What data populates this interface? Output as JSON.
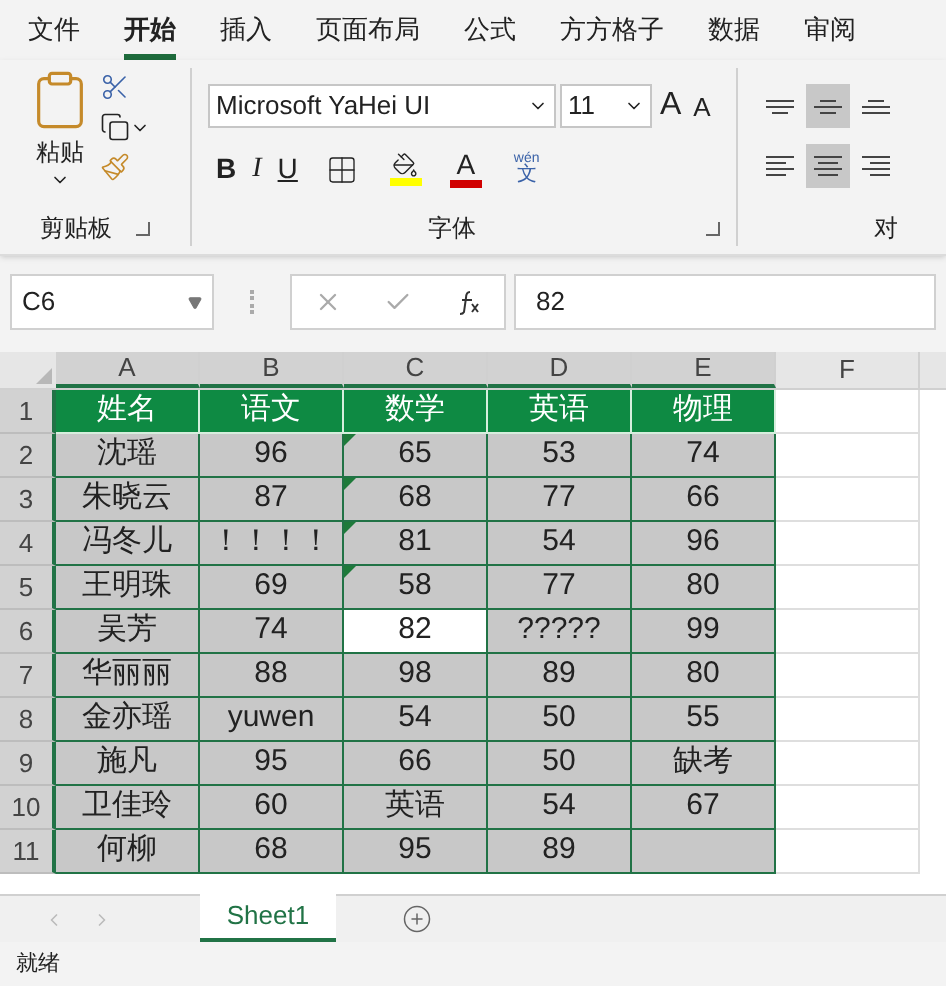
{
  "ribbon_tabs": [
    {
      "label": "文件",
      "selected": false
    },
    {
      "label": "开始",
      "selected": true
    },
    {
      "label": "插入",
      "selected": false
    },
    {
      "label": "页面布局",
      "selected": false
    },
    {
      "label": "公式",
      "selected": false
    },
    {
      "label": "方方格子",
      "selected": false
    },
    {
      "label": "数据",
      "selected": false
    },
    {
      "label": "审阅",
      "selected": false
    }
  ],
  "clipboard": {
    "paste_label": "粘贴",
    "group_label": "剪贴板"
  },
  "font": {
    "name": "Microsoft YaHei UI",
    "size": "11",
    "grow": "A",
    "shrink": "A",
    "bold": "B",
    "italic": "I",
    "underline": "U",
    "font_color": "A",
    "phonetic_top": "wén",
    "phonetic_bottom": "文",
    "group_label": "字体"
  },
  "alignment": {
    "group_label": "对",
    "top_row": [
      {
        "kind": "top",
        "selected": false
      },
      {
        "kind": "middle",
        "selected": true
      },
      {
        "kind": "bottom",
        "selected": false
      }
    ],
    "bottom_row": [
      {
        "kind": "left",
        "selected": false
      },
      {
        "kind": "center",
        "selected": true
      },
      {
        "kind": "right",
        "selected": false
      }
    ]
  },
  "formula_bar": {
    "name_box": "C6",
    "value": "82"
  },
  "columns": [
    "A",
    "B",
    "C",
    "D",
    "E",
    "F"
  ],
  "rows": [
    {
      "number": "1",
      "header": true,
      "cells": [
        {
          "text": "姓名"
        },
        {
          "text": "语文"
        },
        {
          "text": "数学"
        },
        {
          "text": "英语"
        },
        {
          "text": "物理"
        }
      ]
    },
    {
      "number": "2",
      "header": false,
      "cells": [
        {
          "text": "沈瑶",
          "selected": false,
          "error_flag": false
        },
        {
          "text": "96",
          "selected": false,
          "error_flag": false
        },
        {
          "text": "65",
          "selected": false,
          "error_flag": true
        },
        {
          "text": "53",
          "selected": false,
          "error_flag": false
        },
        {
          "text": "74",
          "selected": false,
          "error_flag": false
        }
      ]
    },
    {
      "number": "3",
      "header": false,
      "cells": [
        {
          "text": "朱晓云",
          "selected": false,
          "error_flag": false
        },
        {
          "text": "87",
          "selected": false,
          "error_flag": false
        },
        {
          "text": "68",
          "selected": false,
          "error_flag": true
        },
        {
          "text": "77",
          "selected": false,
          "error_flag": false
        },
        {
          "text": "66",
          "selected": false,
          "error_flag": false
        }
      ]
    },
    {
      "number": "4",
      "header": false,
      "cells": [
        {
          "text": "冯冬儿",
          "selected": false,
          "error_flag": false
        },
        {
          "text": "！！！！",
          "selected": false,
          "error_flag": false
        },
        {
          "text": "81",
          "selected": false,
          "error_flag": true
        },
        {
          "text": "54",
          "selected": false,
          "error_flag": false
        },
        {
          "text": "96",
          "selected": false,
          "error_flag": false
        }
      ]
    },
    {
      "number": "5",
      "header": false,
      "cells": [
        {
          "text": "王明珠",
          "selected": false,
          "error_flag": false
        },
        {
          "text": "69",
          "selected": false,
          "error_flag": false
        },
        {
          "text": "58",
          "selected": false,
          "error_flag": true
        },
        {
          "text": "77",
          "selected": false,
          "error_flag": false
        },
        {
          "text": "80",
          "selected": false,
          "error_flag": false
        }
      ]
    },
    {
      "number": "6",
      "header": false,
      "cells": [
        {
          "text": "吴芳",
          "selected": false,
          "error_flag": false
        },
        {
          "text": "74",
          "selected": false,
          "error_flag": false
        },
        {
          "text": "82",
          "selected": true,
          "error_flag": false
        },
        {
          "text": "?????",
          "selected": false,
          "error_flag": false
        },
        {
          "text": "99",
          "selected": false,
          "error_flag": false
        }
      ]
    },
    {
      "number": "7",
      "header": false,
      "cells": [
        {
          "text": "华丽丽",
          "selected": false,
          "error_flag": false
        },
        {
          "text": "88",
          "selected": false,
          "error_flag": false
        },
        {
          "text": "98",
          "selected": false,
          "error_flag": false
        },
        {
          "text": "89",
          "selected": false,
          "error_flag": false
        },
        {
          "text": "80",
          "selected": false,
          "error_flag": false
        }
      ]
    },
    {
      "number": "8",
      "header": false,
      "cells": [
        {
          "text": "金亦瑶",
          "selected": false,
          "error_flag": false
        },
        {
          "text": "yuwen",
          "selected": false,
          "error_flag": false
        },
        {
          "text": "54",
          "selected": false,
          "error_flag": false
        },
        {
          "text": "50",
          "selected": false,
          "error_flag": false
        },
        {
          "text": "55",
          "selected": false,
          "error_flag": false
        }
      ]
    },
    {
      "number": "9",
      "header": false,
      "cells": [
        {
          "text": "施凡",
          "selected": false,
          "error_flag": false
        },
        {
          "text": "95",
          "selected": false,
          "error_flag": false
        },
        {
          "text": "66",
          "selected": false,
          "error_flag": false
        },
        {
          "text": "50",
          "selected": false,
          "error_flag": false
        },
        {
          "text": "缺考",
          "selected": false,
          "error_flag": false
        }
      ]
    },
    {
      "number": "10",
      "header": false,
      "cells": [
        {
          "text": "卫佳玲",
          "selected": false,
          "error_flag": false
        },
        {
          "text": "60",
          "selected": false,
          "error_flag": false
        },
        {
          "text": "英语",
          "selected": false,
          "error_flag": false
        },
        {
          "text": "54",
          "selected": false,
          "error_flag": false
        },
        {
          "text": "67",
          "selected": false,
          "error_flag": false
        }
      ]
    },
    {
      "number": "11",
      "header": false,
      "cells": [
        {
          "text": "何柳",
          "selected": false,
          "error_flag": false
        },
        {
          "text": "68",
          "selected": false,
          "error_flag": false
        },
        {
          "text": "95",
          "selected": false,
          "error_flag": false
        },
        {
          "text": "89",
          "selected": false,
          "error_flag": false
        },
        {
          "selected": false,
          "error_flag": false
        }
      ]
    }
  ],
  "sheet_tabs": [
    {
      "label": "Sheet1",
      "selected": true
    }
  ],
  "status_bar": {
    "text": "就绪"
  }
}
